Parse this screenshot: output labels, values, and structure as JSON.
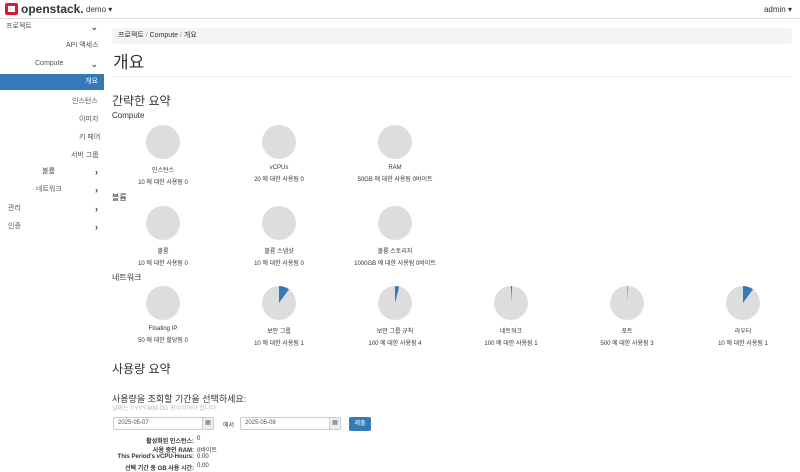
{
  "header": {
    "brand": "openstack.",
    "project": "demo ▾",
    "user": "admin ▾"
  },
  "sidebar": {
    "project": "프로젝트",
    "api_access": "API 액세스",
    "compute": "Compute",
    "overview": "개요",
    "instances": "인스턴스",
    "images": "이미지",
    "keypairs": "키 페어",
    "server_groups": "서버 그룹",
    "volumes": "볼륨",
    "network": "네트워크",
    "admin": "관리",
    "identity": "인증"
  },
  "breadcrumb": {
    "a": "프로젝트",
    "b": "Compute",
    "c": "개요",
    "sep": "/"
  },
  "page_title": "개요",
  "summary": {
    "heading": "간략한 요약",
    "compute": "Compute",
    "volume": "볼륨",
    "network": "네트워크"
  },
  "compute_charts": [
    {
      "label": "인스턴스",
      "sub": "10 에 대한 사용됨 0",
      "fraction": 0
    },
    {
      "label": "vCPUs",
      "sub": "20 에 대한 사용됨 0",
      "fraction": 0
    },
    {
      "label": "RAM",
      "sub": "50GB 에 대한 사용됨 0바이트",
      "fraction": 0
    }
  ],
  "volume_charts": [
    {
      "label": "볼륨",
      "sub": "10 에 대한 사용됨 0",
      "fraction": 0
    },
    {
      "label": "볼륨 스냅샷",
      "sub": "10 에 대한 사용됨 0",
      "fraction": 0
    },
    {
      "label": "볼륨 스토리지",
      "sub": "1000GB 에 대한 사용됨 0바이트",
      "fraction": 0
    }
  ],
  "network_charts": [
    {
      "label": "Floating IP",
      "sub": "50 에 대한 할당됨 0",
      "fraction": 0
    },
    {
      "label": "보안 그룹",
      "sub": "10 에 대한 사용됨 1",
      "fraction": 0.1
    },
    {
      "label": "보안 그룹 규칙",
      "sub": "100 에 대한 사용됨 4",
      "fraction": 0.04
    },
    {
      "label": "네트워크",
      "sub": "100 에 대한 사용됨 1",
      "fraction": 0.01
    },
    {
      "label": "포트",
      "sub": "500 에 대한 사용됨 3",
      "fraction": 0.006
    },
    {
      "label": "라우터",
      "sub": "10 에 대한 사용됨 1",
      "fraction": 0.1
    }
  ],
  "usage": {
    "heading": "사용량 요약",
    "prompt": "사용량을 조회할 기간을 선택하세요:",
    "hint": "날짜는 YYYY-MM-DD 형식이어야 합니다.",
    "start": "2025-05-07",
    "to": "에서",
    "end": "2025-05-08",
    "submit": "제출",
    "stats": [
      {
        "k": "활성화된 인스턴스:",
        "v": "0"
      },
      {
        "k": "사용 중인 RAM:",
        "v": "0바이트"
      },
      {
        "k": "This Period's vCPU-Hours:",
        "v": "0.00"
      },
      {
        "k": "선택 기간 중 GB 사용 시간:",
        "v": "0.00"
      }
    ]
  },
  "colors": {
    "accent": "#337ab7",
    "pie_bg": "#dddddd"
  }
}
